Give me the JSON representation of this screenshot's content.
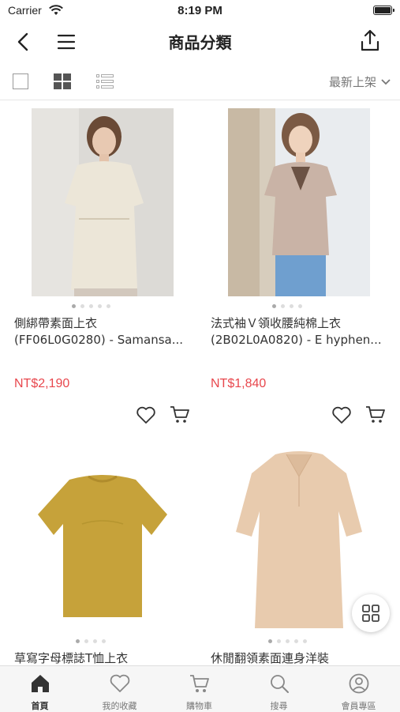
{
  "status": {
    "carrier": "Carrier",
    "time": "8:19 PM"
  },
  "nav": {
    "title": "商品分類"
  },
  "toolbar": {
    "sort_label": "最新上架"
  },
  "products": [
    {
      "name_line1": "側綁帶素面上衣",
      "name_line2": "(FF06L0G0280) - Samansa...",
      "price": "NT$2,190"
    },
    {
      "name_line1": "法式袖Ｖ領收腰純棉上衣",
      "name_line2": "(2B02L0A0820) - E hyphen...",
      "price": "NT$1,840"
    },
    {
      "name_line1": "草寫字母標誌T恤上衣",
      "name_line2": "",
      "price": ""
    },
    {
      "name_line1": "休閒翻領素面連身洋裝",
      "name_line2": "",
      "price": ""
    }
  ],
  "tabs": [
    {
      "label": "首頁",
      "icon": "home-icon"
    },
    {
      "label": "我的收藏",
      "icon": "heart-icon"
    },
    {
      "label": "購物車",
      "icon": "cart-icon"
    },
    {
      "label": "搜尋",
      "icon": "search-icon"
    },
    {
      "label": "會員專區",
      "icon": "user-icon"
    }
  ],
  "colors": {
    "price": "#e8474d",
    "accent": "#333333"
  }
}
